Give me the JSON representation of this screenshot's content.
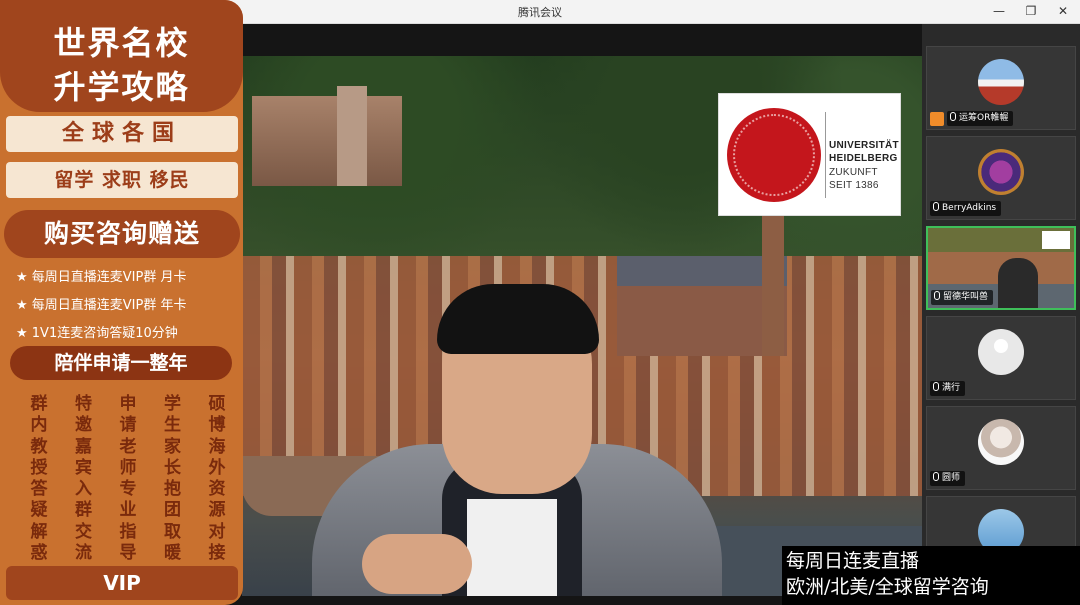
{
  "window": {
    "title": "腾讯会议"
  },
  "promo": {
    "title_line1": "世界名校",
    "title_line2": "升学攻略",
    "band1": "全球各国",
    "band2": "留学 求职 移民",
    "gift": "购买咨询赠送",
    "items": [
      "★ 每周日直播连麦VIP群 月卡",
      "★ 每周日直播连麦VIP群 年卡",
      "★ 1V1连麦咨询答疑10分钟"
    ],
    "year": "陪伴申请一整年",
    "columns": [
      "群内教授答疑解惑",
      "特邀嘉宾入群交流",
      "申请老师专业指导",
      "学生家长抱团取暖",
      "硕博海外资源对接"
    ],
    "vip": "VIP"
  },
  "logo": {
    "line1": "UNIVERSITÄT",
    "line2": "HEIDELBERG",
    "line3": "ZUKUNFT",
    "line4": "SEIT 1386"
  },
  "participants": [
    {
      "name": "运筹OR帷幄"
    },
    {
      "name": "BerryAdkins"
    },
    {
      "name": "留德华叫兽"
    },
    {
      "name": "满行"
    },
    {
      "name": "圆师"
    }
  ],
  "subtitle": {
    "line1": "每周日连麦直播",
    "line2": "欧洲/北美/全球留学咨询"
  },
  "colors": {
    "promo_bg": "#c9712f",
    "promo_dark": "#a0451d",
    "active_border": "#3fbf5a",
    "seal_red": "#c4161c"
  }
}
